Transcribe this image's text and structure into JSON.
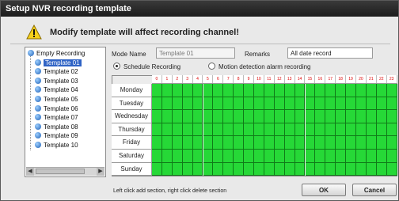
{
  "window": {
    "title": "Setup NVR recording template"
  },
  "warning": {
    "text": "Modify template will affect recording channel!"
  },
  "templates": [
    {
      "label": "Empty Recording",
      "selected": false
    },
    {
      "label": "Template 01",
      "selected": true
    },
    {
      "label": "Template 02",
      "selected": false
    },
    {
      "label": "Template 03",
      "selected": false
    },
    {
      "label": "Template 04",
      "selected": false
    },
    {
      "label": "Template 05",
      "selected": false
    },
    {
      "label": "Template 06",
      "selected": false
    },
    {
      "label": "Template 07",
      "selected": false
    },
    {
      "label": "Template 08",
      "selected": false
    },
    {
      "label": "Template 09",
      "selected": false
    },
    {
      "label": "Template 10",
      "selected": false
    }
  ],
  "form": {
    "mode_name_label": "Mode Name",
    "mode_name_value": "Template 01",
    "remarks_label": "Remarks",
    "remarks_value": "All date record"
  },
  "radios": {
    "schedule_label": "Schedule Recording",
    "motion_label": "Motion detection alarm recording",
    "selected": "schedule"
  },
  "schedule": {
    "hours": [
      "0",
      "1",
      "2",
      "3",
      "4",
      "5",
      "6",
      "7",
      "8",
      "9",
      "10",
      "11",
      "12",
      "13",
      "14",
      "15",
      "16",
      "17",
      "18",
      "19",
      "20",
      "21",
      "22",
      "23"
    ],
    "days": [
      "Monday",
      "Tuesday",
      "Wednesday",
      "Thursday",
      "Friday",
      "Saturday",
      "Sunday"
    ],
    "all_recording": true,
    "record_color": "#26d837"
  },
  "footer": {
    "hint": "Left click add section, right click delete section",
    "ok_label": "OK",
    "cancel_label": "Cancel"
  },
  "icons": {
    "warning": "warning-triangle-icon",
    "template": "template-node-icon"
  }
}
